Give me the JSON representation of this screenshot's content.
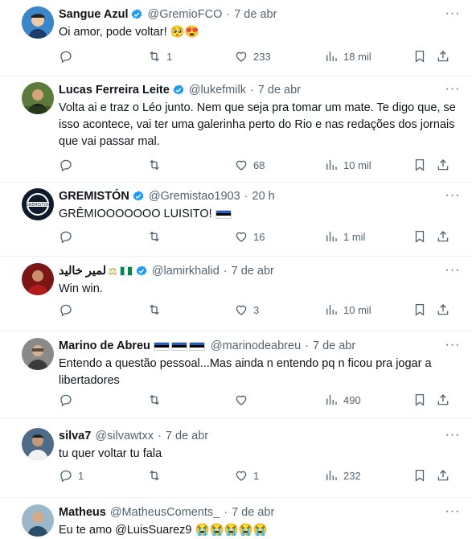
{
  "tweets": [
    {
      "name": "Sangue Azul",
      "handle": "@GremioFCO",
      "date": "7 de abr",
      "text": "Oi amor, pode voltar! 🥺😍",
      "reply_count": "",
      "retweet_count": "1",
      "like_count": "233",
      "view_count": "18 mil"
    },
    {
      "name": "Lucas Ferreira Leite",
      "handle": "@lukefmilk",
      "date": "7 de abr",
      "text": "Volta ai e traz o Léo junto. Nem que seja pra tomar um mate. Te digo que, se isso acontece, vai ter uma galerinha perto do Rio e nas redações dos jornais que vai passar mal.",
      "reply_count": "",
      "retweet_count": "",
      "like_count": "68",
      "view_count": "10 mil"
    },
    {
      "name": "GREMISTÓN",
      "handle": "@Gremistao1903",
      "date": "20 h",
      "text": "GRÊMIOOOOOOO LUISITO!",
      "reply_count": "",
      "retweet_count": "",
      "like_count": "16",
      "view_count": "1 mil"
    },
    {
      "name": "لمير خاليد",
      "handle": "@lamirkhalid",
      "date": "7 de abr",
      "text": "Win win.",
      "reply_count": "",
      "retweet_count": "",
      "like_count": "3",
      "view_count": "10 mil"
    },
    {
      "name": "Marino de Abreu",
      "handle": "@marinodeabreu",
      "date": "7 de abr",
      "text": "Entendo a questão pessoal...Mas ainda n entendo pq n ficou pra jogar a libertadores",
      "reply_count": "",
      "retweet_count": "",
      "like_count": "",
      "view_count": "490"
    },
    {
      "name": "silva7",
      "handle": "@silvawtxx",
      "date": "7 de abr",
      "text": "tu quer voltar tu fala",
      "reply_count": "1",
      "retweet_count": "",
      "like_count": "1",
      "view_count": "232"
    },
    {
      "name": "Matheus",
      "handle": "@MatheusComents_",
      "date": "7 de abr",
      "text": "Eu te amo @LuisSuarez9 😭😭😭😭😭"
    }
  ],
  "colors": {
    "verified": "#1d9bf0",
    "muted": "#536471",
    "text": "#0f1419",
    "divider": "#eff3f4"
  },
  "icons": [
    "reply-icon",
    "retweet-icon",
    "like-icon",
    "views-icon",
    "bookmark-icon",
    "share-icon",
    "more-icon",
    "verified-icon"
  ]
}
